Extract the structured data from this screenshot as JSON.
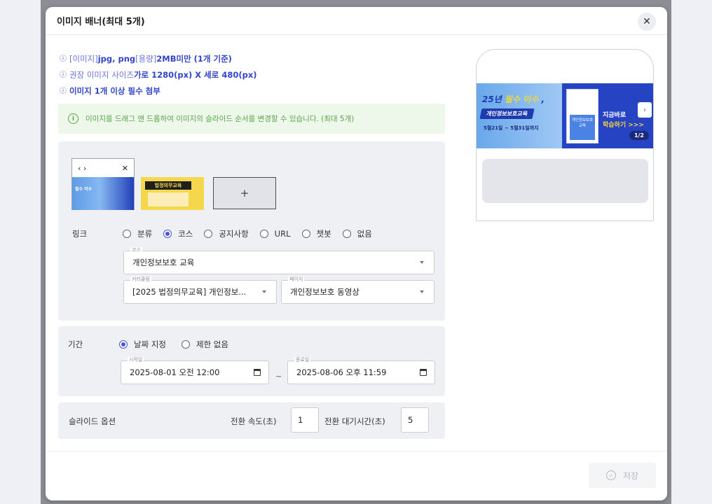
{
  "modal": {
    "title": "이미지 배너(최대 5개)",
    "close_label": "✕"
  },
  "notes": [
    {
      "icon": "ⓘ",
      "parts": [
        "[이미지] ",
        "jpg, png",
        " [용량] ",
        "2MB미만 (1개 기준)"
      ]
    },
    {
      "icon": "ⓘ",
      "parts": [
        "권장 이미지 사이즈 ",
        "가로 1280(px) X 세로 480(px)"
      ]
    },
    {
      "icon": "ⓘ",
      "parts": [
        "이미지 1개 이상 필수 첨부"
      ]
    }
  ],
  "alert": {
    "icon": "i",
    "text": "이미지를 드래그 앤 드롭하여 이미지의 슬라이드 순서를 변경할 수 있습니다. (최대 5개)"
  },
  "thumbs": {
    "thumb1_nav": "‹ ›",
    "thumb1_close": "✕",
    "thumb1_text": "필수 이수",
    "thumb2_text": "법정의무교육",
    "add_label": "+"
  },
  "link": {
    "label": "링크",
    "options": [
      {
        "label": "분류",
        "checked": false
      },
      {
        "label": "코스",
        "checked": true
      },
      {
        "label": "공지사항",
        "checked": false
      },
      {
        "label": "URL",
        "checked": false
      },
      {
        "label": "챗봇",
        "checked": false
      },
      {
        "label": "없음",
        "checked": false
      }
    ],
    "course_label": "코스",
    "course_value": "개인정보보호 교육",
    "curriculum_label": "커리큘럼",
    "curriculum_value": "[2025 법정의무교육] 개인정보...",
    "page_label": "페이지",
    "page_value": "개인정보보호 동영상"
  },
  "period": {
    "label": "기간",
    "options": [
      {
        "label": "날짜 지정",
        "checked": true
      },
      {
        "label": "제한 없음",
        "checked": false
      }
    ],
    "start_label": "시작일",
    "start_value": "2025-08-01 오전 12:00",
    "separator": "~",
    "end_label": "종료일",
    "end_value": "2025-08-06 오후 11:59"
  },
  "slide": {
    "label": "슬라이드 옵션",
    "speed_label": "전환 속도(초)",
    "speed_value": "1",
    "wait_label": "전환 대기시간(초)",
    "wait_value": "5"
  },
  "save": {
    "label": "저장",
    "icon": "✓"
  },
  "preview": {
    "title_a": "25년 ",
    "title_b": "필수 이수",
    "title_c": " ,",
    "pill": "개인정보보호교육",
    "date": "5월21일 ~ 5월31일까지",
    "book_text": "개인정보보호 교육",
    "cta1": "지금바로",
    "cta2": "학습하기 >>>",
    "next": "›",
    "counter": "1/2"
  },
  "colors": {
    "accent": "#4a55d8",
    "note_blue": "#4a5bd8",
    "alert_green": "#5aa34d",
    "panel_bg": "#eef0f4"
  }
}
